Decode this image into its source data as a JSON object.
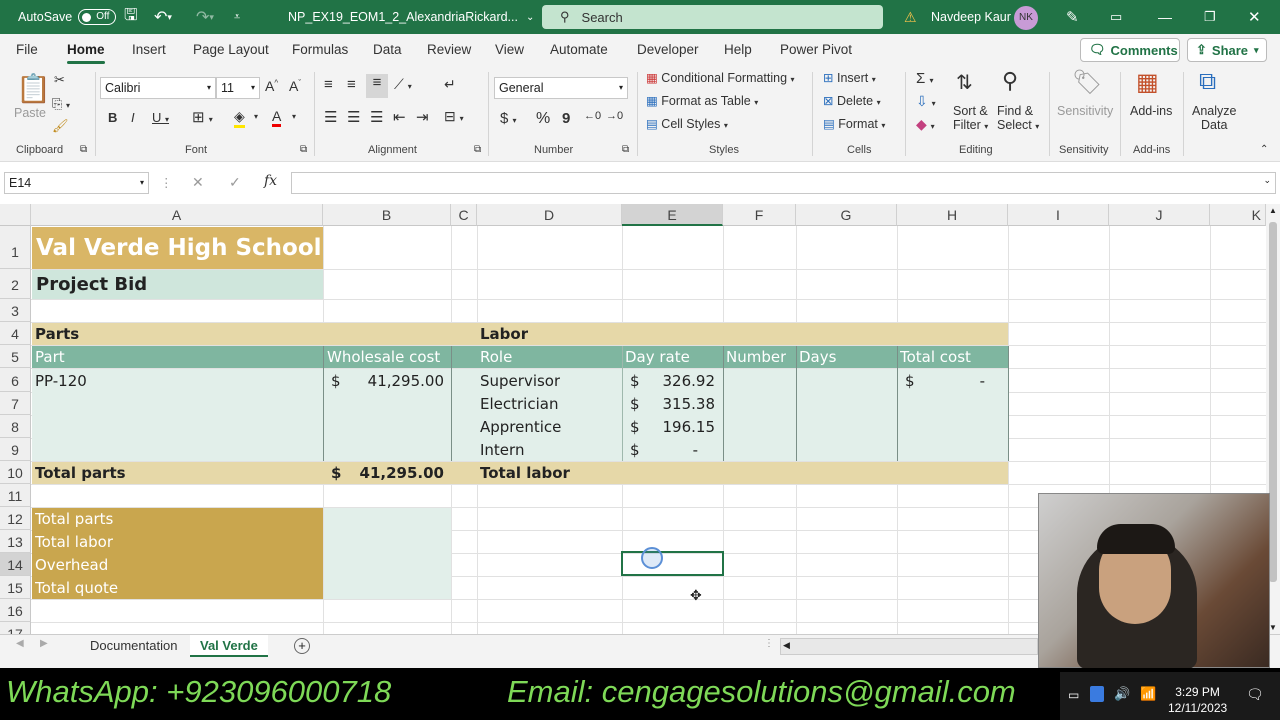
{
  "titlebar": {
    "autosave_label": "AutoSave",
    "autosave_state": "Off",
    "filename": "NP_EX19_EOM1_2_AlexandriaRickard...",
    "search_placeholder": "Search",
    "user_name": "Navdeep Kaur",
    "user_initials": "NK"
  },
  "menu": [
    "File",
    "Home",
    "Insert",
    "Page Layout",
    "Formulas",
    "Data",
    "Review",
    "View",
    "Automate",
    "Developer",
    "Help",
    "Power Pivot"
  ],
  "menu_active": "Home",
  "header_buttons": {
    "comments": "Comments",
    "share": "Share"
  },
  "ribbon": {
    "clipboard": {
      "paste": "Paste",
      "label": "Clipboard"
    },
    "font": {
      "name": "Calibri",
      "size": "11",
      "label": "Font"
    },
    "alignment": {
      "label": "Alignment"
    },
    "number": {
      "format": "General",
      "label": "Number"
    },
    "styles": {
      "conditional": "Conditional Formatting",
      "format_table": "Format as Table",
      "cell_styles": "Cell Styles",
      "label": "Styles"
    },
    "cells": {
      "insert": "Insert",
      "delete": "Delete",
      "format": "Format",
      "label": "Cells"
    },
    "editing": {
      "sort": "Sort &",
      "sort2": "Filter",
      "find": "Find &",
      "find2": "Select",
      "label": "Editing"
    },
    "sensitivity": {
      "btn": "Sensitivity",
      "label": "Sensitivity"
    },
    "addins": {
      "btn": "Add-ins",
      "label": "Add-ins"
    },
    "analyze": {
      "btn": "Analyze",
      "btn2": "Data"
    }
  },
  "formula_bar": {
    "name_box": "E14",
    "fx": "fx",
    "formula": ""
  },
  "columns": [
    "A",
    "B",
    "C",
    "D",
    "E",
    "F",
    "G",
    "H",
    "I",
    "J",
    "K"
  ],
  "selected_column": "E",
  "rows": [
    "1",
    "2",
    "3",
    "4",
    "5",
    "6",
    "7",
    "8",
    "9",
    "10",
    "11",
    "12",
    "13",
    "14",
    "15",
    "16",
    "17"
  ],
  "selected_row": "14",
  "sheet": {
    "title": "Val Verde High School",
    "subtitle": "Project Bid",
    "parts_header": "Parts",
    "labor_header": "Labor",
    "part_col": "Part",
    "wholesale_col": "Wholesale cost",
    "role_col": "Role",
    "dayrate_col": "Day rate",
    "number_col": "Number",
    "days_col": "Days",
    "totalcost_col": "Total cost",
    "part1": "PP-120",
    "part1_cost_sym": "$",
    "part1_cost": "41,295.00",
    "roles": [
      "Supervisor",
      "Electrician",
      "Apprentice",
      "Intern"
    ],
    "rates_sym": "$",
    "rates": [
      "326.92",
      "315.38",
      "196.15",
      "-"
    ],
    "total_cost_sym": "$",
    "total_cost_val": "-",
    "total_parts_label": "Total parts",
    "total_parts_sym": "$",
    "total_parts_val": "41,295.00",
    "total_labor_label": "Total labor",
    "summary": [
      "Total parts",
      "Total labor",
      "Overhead",
      "Total quote"
    ]
  },
  "sheet_tabs": [
    "Documentation",
    "Val Verde"
  ],
  "active_tab": "Val Verde",
  "banner": {
    "whatsapp": "WhatsApp: +923096000718",
    "email": "Email: cengagesolutions@gmail.com"
  },
  "taskbar": {
    "time": "3:29 PM",
    "date": "12/11/2023"
  },
  "colors": {
    "excel_green": "#217346",
    "title_gold": "#d9b666",
    "subtitle_green": "#cfe6dc",
    "header_tan": "#e6d8a8",
    "header_teal": "#7fb6a0",
    "body_light": "#e2efea",
    "summary_gold": "#c9a64e"
  }
}
